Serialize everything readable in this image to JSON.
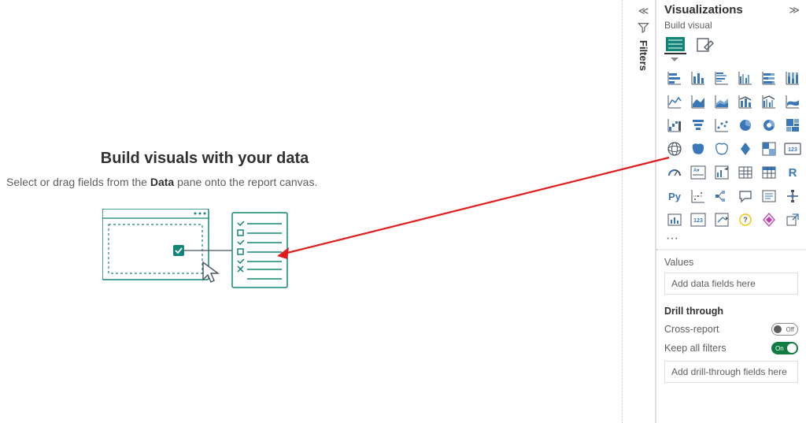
{
  "canvas": {
    "title": "Build visuals with your data",
    "subtitle_pre": "Select or drag fields from the ",
    "subtitle_bold": "Data",
    "subtitle_post": " pane onto the report canvas."
  },
  "filters_pane": {
    "label": "Filters"
  },
  "viz_pane": {
    "title": "Visualizations",
    "subtitle": "Build visual",
    "ellipsis": "···",
    "values_label": "Values",
    "values_placeholder": "Add data fields here",
    "drill_label": "Drill through",
    "cross_report_label": "Cross-report",
    "cross_report_state": "Off",
    "keep_filters_label": "Keep all filters",
    "keep_filters_state": "On",
    "drill_placeholder": "Add drill-through fields here",
    "items": [
      "stacked-bar",
      "stacked-column",
      "clustered-bar",
      "clustered-column",
      "stacked-bar-100",
      "stacked-column-100",
      "line",
      "area",
      "stacked-area",
      "line-stacked-column",
      "line-clustered-column",
      "ribbon",
      "waterfall",
      "funnel",
      "scatter",
      "pie",
      "donut",
      "treemap",
      "map",
      "filled-map",
      "azure-map",
      "arcgis",
      "shape-map",
      "card-123",
      "gauge",
      "multi-row-card",
      "kpi",
      "table",
      "matrix",
      "r-visual",
      "python",
      "key-influencers",
      "decomposition",
      "qna",
      "smart-narrative",
      "paginated",
      "metrics",
      "app",
      "scorecard",
      "get-more",
      "power-apps",
      "export"
    ],
    "special_text": {
      "r-visual": "R",
      "python": "Py",
      "card-123": ""
    }
  },
  "colors": {
    "teal": "#118578",
    "blue": "#3a77b7",
    "dark": "#4b5563",
    "green_toggle": "#107c41",
    "arrow": "#e11b1b"
  }
}
